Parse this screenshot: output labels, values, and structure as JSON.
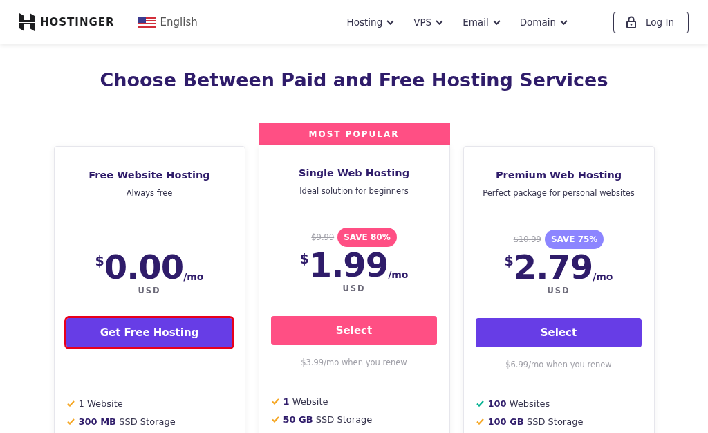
{
  "header": {
    "brand": "HOSTINGER",
    "language": "English",
    "nav": [
      {
        "label": "Hosting"
      },
      {
        "label": "VPS"
      },
      {
        "label": "Email"
      },
      {
        "label": "Domain"
      }
    ],
    "login": "Log In"
  },
  "heading": "Choose Between Paid and Free Hosting Services",
  "plans": [
    {
      "name": "Free Website Hosting",
      "subtitle": "Always free",
      "price": {
        "currency": "$",
        "amount": "0.00",
        "period": "/mo"
      },
      "currency_code": "USD",
      "button": {
        "label": "Get Free Hosting",
        "color": "#673de6",
        "highlighted": true
      },
      "features": [
        {
          "text": "1 Website",
          "color": "#f5a623"
        },
        {
          "text": "**300 MB** SSD Storage",
          "color": "#f5a623"
        }
      ]
    },
    {
      "ribbon": "MOST POPULAR",
      "name": "Single Web Hosting",
      "subtitle": "Ideal solution for beginners",
      "old_price": "$9.99",
      "badge": {
        "label": "SAVE 80%",
        "color": "#ff4f84"
      },
      "price": {
        "currency": "$",
        "amount": "1.99",
        "period": "/mo"
      },
      "currency_code": "USD",
      "button": {
        "label": "Select",
        "color": "#ff4f84",
        "highlighted": false
      },
      "renewal": "$3.99/mo when you renew",
      "features": [
        {
          "text": "**1** Website",
          "color": "#f5a623"
        },
        {
          "text": "**50 GB** SSD Storage",
          "color": "#f5a623"
        }
      ]
    },
    {
      "name": "Premium Web Hosting",
      "subtitle": "Perfect package for personal websites",
      "old_price": "$10.99",
      "badge": {
        "label": "SAVE 75%",
        "color": "#8c85ff"
      },
      "price": {
        "currency": "$",
        "amount": "2.79",
        "period": "/mo"
      },
      "currency_code": "USD",
      "button": {
        "label": "Select",
        "color": "#673de6",
        "highlighted": false
      },
      "renewal": "$6.99/mo when you renew",
      "features": [
        {
          "text": "**100** Websites",
          "color": "#00b090"
        },
        {
          "text": "**100 GB** SSD Storage",
          "color": "#f5a623"
        }
      ]
    }
  ]
}
